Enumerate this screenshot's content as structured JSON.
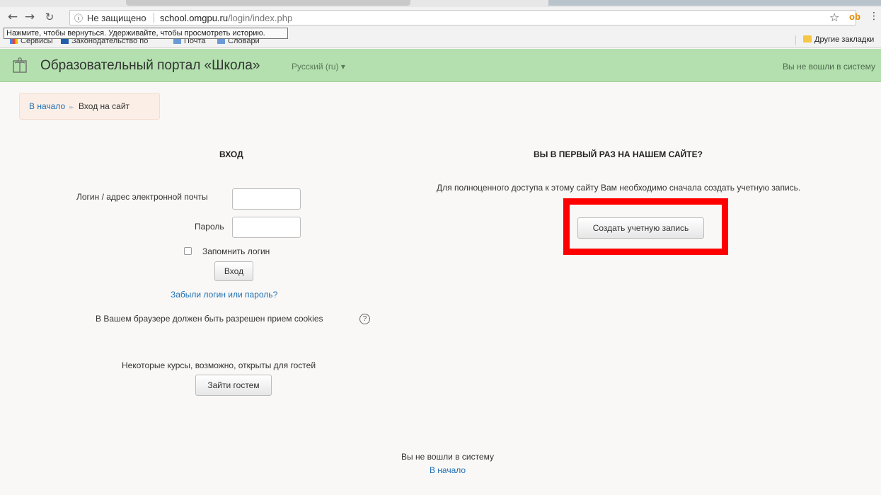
{
  "browser": {
    "security_label": "Не защищено",
    "url_host": "school.omgpu.ru",
    "url_path": "/login/index.php",
    "back_tooltip": "Нажмите, чтобы вернуться. Удерживайте, чтобы просмотреть историю.",
    "bookmarks": [
      {
        "label": "Сервисы",
        "icon": "apps-grid-icon"
      },
      {
        "label": "Законодательство по",
        "icon": "bookmark-favicon-icon"
      },
      {
        "label": "Почта",
        "icon": "mail-icon"
      },
      {
        "label": "Словари",
        "icon": "dictionary-icon"
      }
    ],
    "other_bookmarks": "Другие закладки"
  },
  "navbar": {
    "site_title": "Образовательный портал «Школа»",
    "language": "Русский (ru) ▾",
    "login_status": "Вы не вошли в систему"
  },
  "breadcrumb": {
    "home": "В начало",
    "separator": "►",
    "current": "Вход на сайт"
  },
  "login": {
    "heading": "ВХОД",
    "username_label": "Логин / адрес электронной почты",
    "username_value": "",
    "password_label": "Пароль",
    "password_value": "",
    "remember_label": "Запомнить логин",
    "remember_checked": false,
    "submit_label": "Вход",
    "forgot_link": "Забыли логин или пароль?",
    "cookies_notice": "В Вашем браузере должен быть разрешен прием cookies",
    "guest_notice": "Некоторые курсы, возможно, открыты для гостей",
    "guest_button": "Зайти гостем"
  },
  "signup": {
    "heading": "ВЫ В ПЕРВЫЙ РАЗ НА НАШЕМ САЙТЕ?",
    "text": "Для полноценного доступа к этому сайту Вам необходимо сначала создать учетную запись.",
    "button": "Создать учетную запись",
    "highlight_color": "#ff0000"
  },
  "footer": {
    "status": "Вы не вошли в систему",
    "home_link": "В начало"
  },
  "colors": {
    "navbar_bg": "#b3e0ae",
    "link": "#1f6fb4",
    "breadcrumb_bg": "#fbeee6"
  }
}
